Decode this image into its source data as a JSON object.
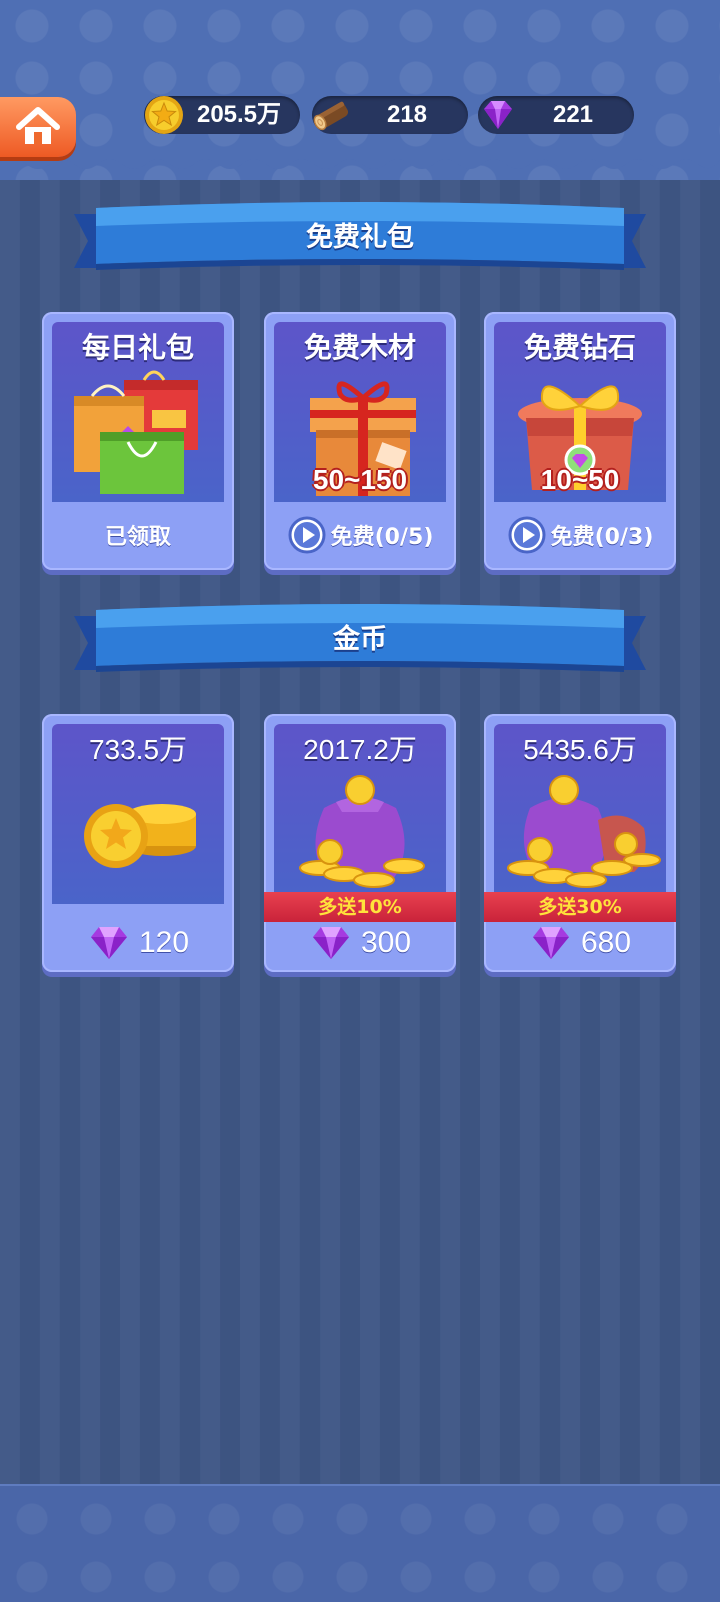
{
  "resources": {
    "coins": "205.5万",
    "wood": "218",
    "gems": "221"
  },
  "banners": {
    "free_gifts": "免费礼包",
    "coins": "金币"
  },
  "free_gift_cards": [
    {
      "title": "每日礼包",
      "range": "",
      "footer": "已领取"
    },
    {
      "title": "免费木材",
      "range": "50~150",
      "footer": "免费(0/5)"
    },
    {
      "title": "免费钻石",
      "range": "10~50",
      "footer": "免费(0/3)"
    }
  ],
  "coin_cards": [
    {
      "amount": "733.5万",
      "bonus": "",
      "price": "120"
    },
    {
      "amount": "2017.2万",
      "bonus": "多送10%",
      "price": "300"
    },
    {
      "amount": "5435.6万",
      "bonus": "多送30%",
      "price": "680"
    }
  ],
  "colors": {
    "background": "#3f5786",
    "header": "#4f6fb4",
    "card": "#8da0f5",
    "bonus_ribbon": "#d72d43",
    "bonus_text": "#ffe33b",
    "home_button": "#ef6a2e"
  }
}
